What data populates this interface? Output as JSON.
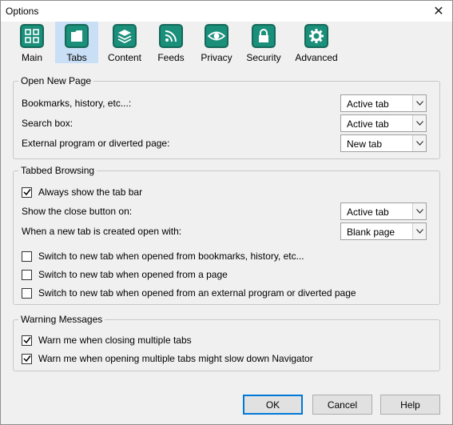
{
  "window": {
    "title": "Options",
    "close_glyph": "✕"
  },
  "toolbar": [
    {
      "label": "Main",
      "icon": "grid-icon"
    },
    {
      "label": "Tabs",
      "icon": "tab-icon"
    },
    {
      "label": "Content",
      "icon": "stack-icon"
    },
    {
      "label": "Feeds",
      "icon": "rss-icon"
    },
    {
      "label": "Privacy",
      "icon": "eye-icon"
    },
    {
      "label": "Security",
      "icon": "lock-icon"
    },
    {
      "label": "Advanced",
      "icon": "gear-icon"
    }
  ],
  "selected_tab": "Tabs",
  "open_new_page": {
    "legend": "Open New Page",
    "rows": [
      {
        "label": "Bookmarks, history, etc...:",
        "value": "Active tab"
      },
      {
        "label": "Search box:",
        "value": "Active tab"
      },
      {
        "label": "External program or diverted page:",
        "value": "New tab"
      }
    ]
  },
  "tabbed_browsing": {
    "legend": "Tabbed Browsing",
    "always_show_tab_bar": {
      "label": "Always show the tab bar",
      "checked": true
    },
    "close_button_row": {
      "label": "Show the close button on:",
      "value": "Active tab"
    },
    "new_tab_row": {
      "label": "When a new tab is created open with:",
      "value": "Blank page"
    },
    "switch_options": [
      {
        "label": "Switch to new tab when opened from bookmarks, history, etc...",
        "checked": false
      },
      {
        "label": "Switch to new tab when opened from a page",
        "checked": false
      },
      {
        "label": "Switch to new tab when opened from an external program or diverted page",
        "checked": false
      }
    ]
  },
  "warning_messages": {
    "legend": "Warning Messages",
    "options": [
      {
        "label": "Warn me when closing multiple tabs",
        "checked": true
      },
      {
        "label": "Warn me when opening multiple tabs might slow down Navigator",
        "checked": true
      }
    ]
  },
  "buttons": {
    "ok": "OK",
    "cancel": "Cancel",
    "help": "Help"
  },
  "colors": {
    "icon_teal": "#1a8f7a",
    "selected_tab_bg": "#c9dff5",
    "default_button_border": "#0078d7"
  }
}
